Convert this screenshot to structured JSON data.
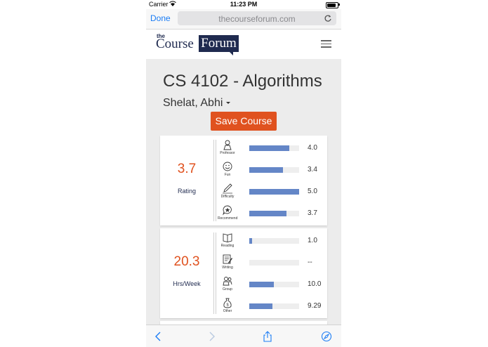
{
  "status_bar": {
    "carrier": "Carrier",
    "time": "11:23 PM"
  },
  "browser": {
    "done_label": "Done",
    "url": "thecourseforum.com"
  },
  "site": {
    "logo_the": "the",
    "logo_course": "Course",
    "logo_forum": "Forum"
  },
  "course": {
    "title": "CS 4102 - Algorithms",
    "professor": "Shelat, Abhi",
    "save_label": "Save Course"
  },
  "rating_card": {
    "big_value": "3.7",
    "big_label": "Rating",
    "metrics": [
      {
        "label": "Professor",
        "value": "4.0",
        "fill": 0.8,
        "icon": "professor-icon"
      },
      {
        "label": "Fun",
        "value": "3.4",
        "fill": 0.68,
        "icon": "smiley-icon"
      },
      {
        "label": "Difficulty",
        "value": "5.0",
        "fill": 1.0,
        "icon": "pencil-icon"
      },
      {
        "label": "Recommend",
        "value": "3.7",
        "fill": 0.74,
        "icon": "star-bubble-icon"
      }
    ]
  },
  "hours_card": {
    "big_value": "20.3",
    "big_label": "Hrs/Week",
    "metrics": [
      {
        "label": "Reading",
        "value": "1.0",
        "fill": 0.05,
        "icon": "book-icon"
      },
      {
        "label": "Writing",
        "value": "--",
        "fill": 0,
        "icon": "writing-icon"
      },
      {
        "label": "Group",
        "value": "10.0",
        "fill": 0.49,
        "icon": "group-icon"
      },
      {
        "label": "Other",
        "value": "9.29",
        "fill": 0.46,
        "icon": "money-bag-icon"
      }
    ]
  },
  "colors": {
    "accent": "#e0521f",
    "navy": "#1f2a4f",
    "bar": "#6486c7",
    "link": "#1a7cf5"
  }
}
